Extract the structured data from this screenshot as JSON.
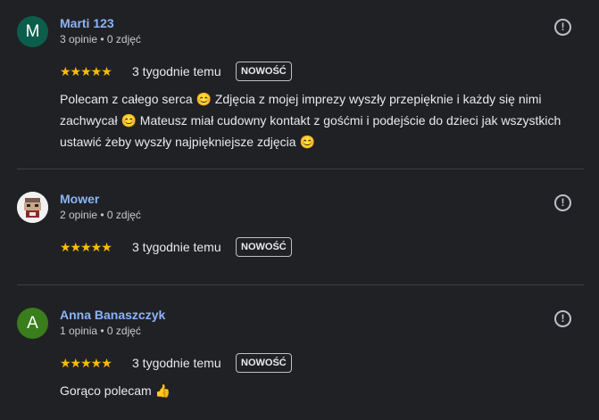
{
  "reviews": [
    {
      "avatar_letter": "M",
      "avatar_color": "#0b5e4c",
      "name": "Marti 123",
      "meta": "3 opinie • 0 zdjęć",
      "stars": "★★★★★",
      "time": "3 tygodnie temu",
      "badge": "NOWOŚĆ",
      "text": "Polecam z całego serca 😊 Zdjęcia z mojej imprezy wyszły przepięknie i każdy się nimi zachwycał 😊 Mateusz miał cudowny kontakt z gośćmi i podejście do dzieci jak wszystkich ustawić żeby wyszły najpiękniejsze zdjęcia 😊"
    },
    {
      "avatar_letter": "",
      "avatar_color": "#f1f1f1",
      "name": "Mower",
      "meta": "2 opinie • 0 zdjęć",
      "stars": "★★★★★",
      "time": "3 tygodnie temu",
      "badge": "NOWOŚĆ",
      "text": ""
    },
    {
      "avatar_letter": "A",
      "avatar_color": "#3a7d1c",
      "name": "Anna Banaszczyk",
      "meta": "1 opinia • 0 zdjęć",
      "stars": "★★★★★",
      "time": "3 tygodnie temu",
      "badge": "NOWOŚĆ",
      "text": "Gorąco polecam 👍"
    }
  ],
  "flag_glyph": "!",
  "colors": {
    "background": "#202124",
    "name_link": "#8ab4f8",
    "star": "#fbbc04"
  }
}
